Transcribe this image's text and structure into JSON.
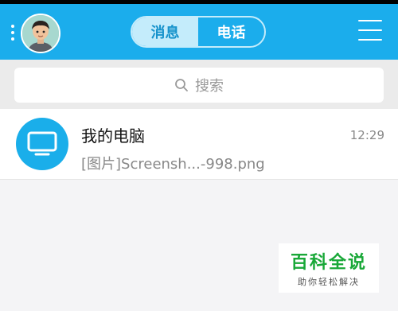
{
  "header": {
    "tabs": [
      {
        "label": "消息",
        "active": true
      },
      {
        "label": "电话",
        "active": false
      }
    ]
  },
  "search": {
    "placeholder": "搜索"
  },
  "conversations": [
    {
      "title": "我的电脑",
      "time": "12:29",
      "preview": "[图片]Screensh...-998.png",
      "icon": "monitor-icon"
    }
  ],
  "watermark": {
    "main": "百科全说",
    "sub": "助你轻松解决"
  },
  "colors": {
    "accent": "#1badec",
    "segment_active_bg": "#c4ecfb",
    "watermark_green": "#19a838"
  }
}
